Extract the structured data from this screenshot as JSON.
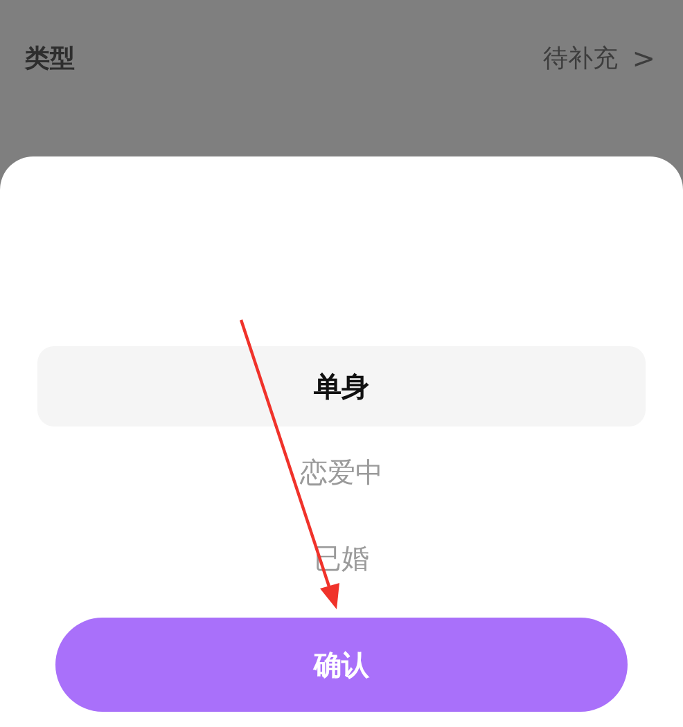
{
  "background_rows": [
    {
      "label": "类型",
      "value": "待补充",
      "chevron": ">"
    }
  ],
  "picker": {
    "options": [
      {
        "label": "单身",
        "selected": true
      },
      {
        "label": "恋爱中",
        "selected": false
      },
      {
        "label": "已婚",
        "selected": false
      }
    ]
  },
  "confirm_button": "确认"
}
